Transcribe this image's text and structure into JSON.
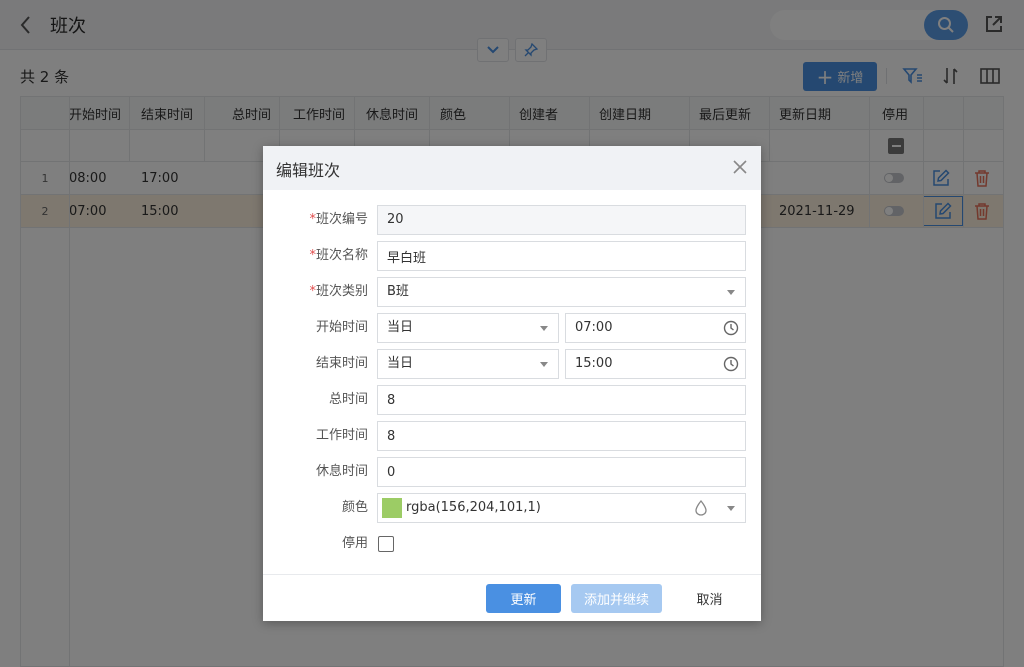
{
  "header": {
    "title": "班次"
  },
  "toolbar": {
    "count_text": "共 2 条",
    "add_label": "新增"
  },
  "table": {
    "columns": [
      "开始时间",
      "结束时间",
      "总时间",
      "工作时间",
      "休息时间",
      "颜色",
      "创建者",
      "创建日期",
      "最后更新",
      "更新日期",
      "停用"
    ],
    "rows": [
      {
        "num": "1",
        "start": "08:00",
        "end": "17:00",
        "update_date": ""
      },
      {
        "num": "2",
        "start": "07:00",
        "end": "15:00",
        "update_date": "2021-11-29"
      }
    ]
  },
  "modal": {
    "title": "编辑班次",
    "labels": {
      "code": "班次编号",
      "name": "班次名称",
      "category": "班次类别",
      "start": "开始时间",
      "end": "结束时间",
      "total": "总时间",
      "work": "工作时间",
      "rest": "休息时间",
      "color": "颜色",
      "disabled": "停用"
    },
    "values": {
      "code": "20",
      "name": "早白班",
      "category": "B班",
      "start_day": "当日",
      "start_time": "07:00",
      "end_day": "当日",
      "end_time": "15:00",
      "total": "8",
      "work": "8",
      "rest": "0",
      "color": "rgba(156,204,101,1)"
    },
    "buttons": {
      "update": "更新",
      "add_continue": "添加并继续",
      "cancel": "取消"
    }
  },
  "colors": {
    "accent": "#4a90e2",
    "swatch": "#9ccc65",
    "highlight_row": "#fdf1df",
    "required": "#e14b4b"
  },
  "icons": [
    "back-icon",
    "search-icon",
    "share-icon",
    "chevron-down-icon",
    "pin-icon",
    "plus-icon",
    "filter-icon",
    "sort-icon",
    "columns-icon",
    "edit-icon",
    "delete-icon",
    "close-icon",
    "clock-icon",
    "drop-icon"
  ]
}
